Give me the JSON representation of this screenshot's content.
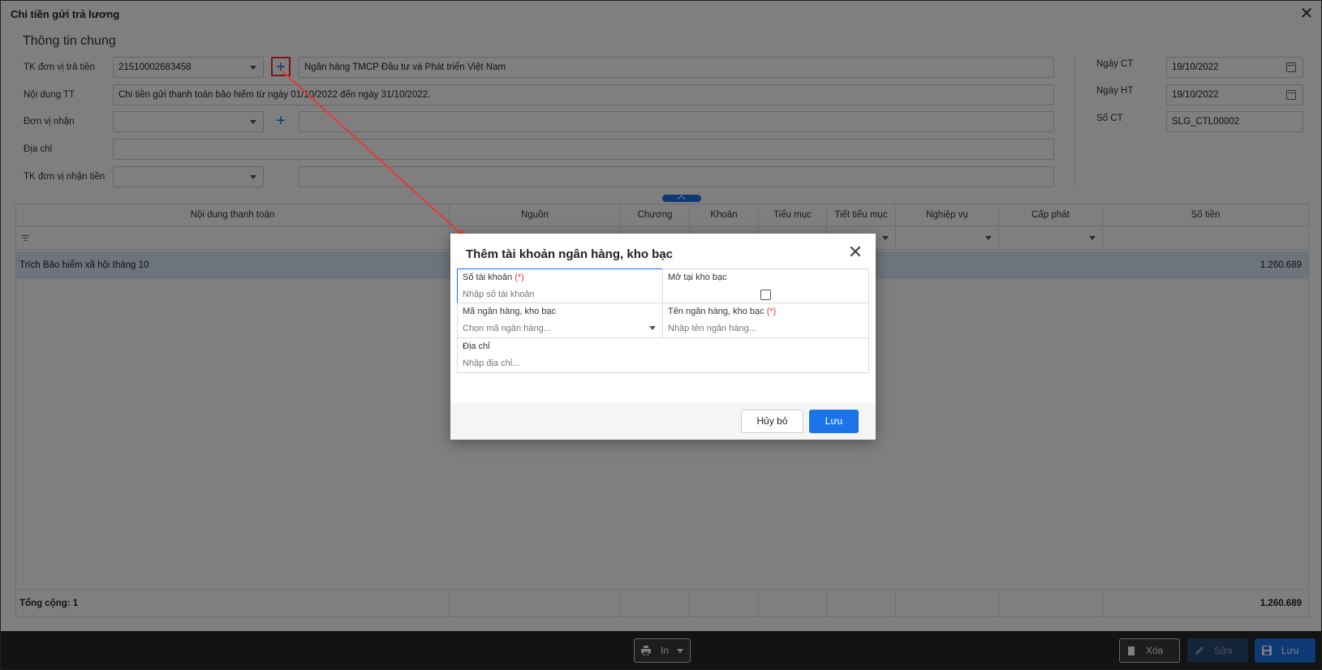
{
  "window": {
    "title": "Chi tiền gửi trả lương"
  },
  "section": {
    "title": "Thông tin chung"
  },
  "form": {
    "tk_don_vi_tra_tien": {
      "label": "TK đơn vị trả tiền",
      "value": "21510002683458",
      "bank_name": "Ngân hàng TMCP Đầu tư và Phát triển Việt Nam"
    },
    "noi_dung_tt": {
      "label": "Nội dung TT",
      "value": "Chi tiền gửi thanh toán bảo hiểm từ ngày 01/10/2022 đến ngày 31/10/2022."
    },
    "don_vi_nhan": {
      "label": "Đơn vị nhận",
      "value": ""
    },
    "dia_chi": {
      "label": "Địa chỉ",
      "value": ""
    },
    "tk_don_vi_nhan_tien": {
      "label": "TK đơn vị nhận tiền",
      "value": ""
    },
    "ngay_ct": {
      "label": "Ngày CT",
      "value": "19/10/2022"
    },
    "ngay_ht": {
      "label": "Ngày HT",
      "value": "19/10/2022"
    },
    "so_ct": {
      "label": "Số CT",
      "value": "SLG_CTL00002"
    }
  },
  "grid": {
    "columns": [
      "Nội dung thanh toán",
      "Nguồn",
      "Chương",
      "Khoản",
      "Tiểu mục",
      "Tiết tiểu mục",
      "Nghiệp vụ",
      "Cấp phát",
      "Số tiền"
    ],
    "rows": [
      {
        "noi_dung": "Trích Bảo hiểm xã hội tháng 10",
        "so_tien": "1.260.689"
      }
    ],
    "footer": {
      "total_label": "Tổng cộng: 1",
      "total_amount": "1.260.689"
    }
  },
  "toolbar": {
    "print_label": "In",
    "delete_label": "Xóa",
    "edit_label": "Sửa",
    "save_label": "Lưu"
  },
  "modal": {
    "title": "Thêm tài khoản ngân hàng, kho bạc",
    "so_tai_khoan": {
      "label": "Số tài khoản",
      "required": "(*)",
      "placeholder": "Nhập số tài khoản"
    },
    "mo_tai_kho_bac": {
      "label": "Mở tại kho bạc"
    },
    "ma_ngan_hang": {
      "label": "Mã ngân hàng, kho bạc",
      "placeholder": "Chọn mã ngân hàng..."
    },
    "ten_ngan_hang": {
      "label": "Tên ngân hàng, kho bạc",
      "required": "(*)",
      "placeholder": "Nhập tên ngân hàng..."
    },
    "dia_chi": {
      "label": "Địa chỉ",
      "placeholder": "Nhập địa chỉ..."
    },
    "cancel_label": "Hủy bỏ",
    "save_label": "Lưu"
  },
  "colors": {
    "accent": "#1a73e8",
    "required": "#e53935",
    "selected_row": "#dbe8f7",
    "toolbar": "#262626"
  }
}
